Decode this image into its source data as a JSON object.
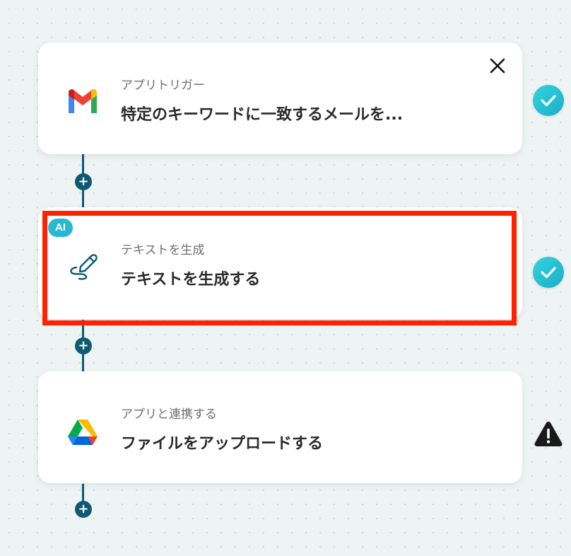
{
  "steps": [
    {
      "app_icon": "gmail-icon",
      "subtitle": "アプリトリガー",
      "title": "特定のキーワードに一致するメールを...",
      "status": "success",
      "close_icon": "close-icon"
    },
    {
      "app_icon": "pen-stroke-icon",
      "badge": "AI",
      "subtitle": "テキストを生成",
      "title": "テキストを生成する",
      "status": "success"
    },
    {
      "app_icon": "google-drive-icon",
      "subtitle": "アプリと連携する",
      "title": "ファイルをアップロードする",
      "status": "warning"
    }
  ],
  "add_step_symbol": "+",
  "colors": {
    "connector": "#0e5a72",
    "success": "#22bfd1",
    "warning": "#1a1a1a",
    "highlight": "#ff2200",
    "ai_badge": "#28b9d2"
  }
}
